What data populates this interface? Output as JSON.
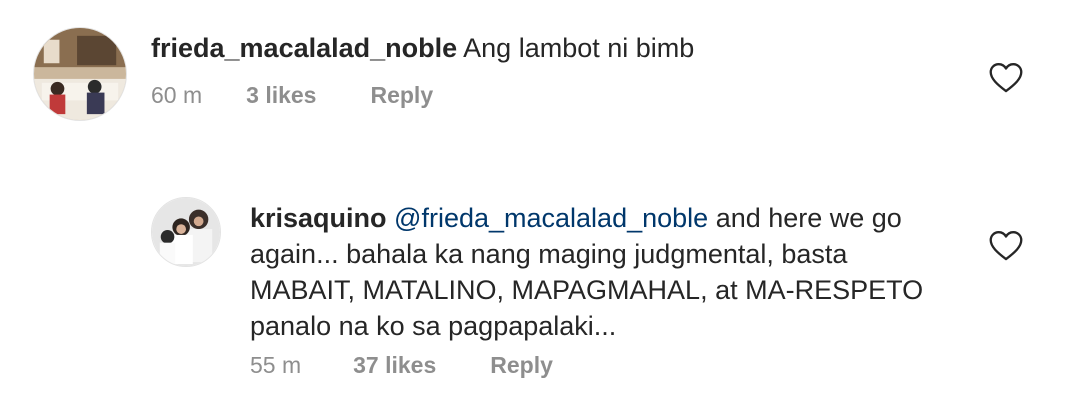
{
  "comments": [
    {
      "username": "frieda_macalalad_noble",
      "text": "Ang lambot ni bimb",
      "time": "60 m",
      "likes": "3 likes",
      "reply": "Reply",
      "like_icon": "heart-outline-icon"
    },
    {
      "username": "krisaquino",
      "mention": "@frieda_macalalad_noble",
      "text_line1": "and here we go",
      "text_line2": "again... bahala ka nang maging judgmental, basta",
      "text_line3": "MABAIT, MATALINO, MAPAGMAHAL, at MA-RESPETO",
      "text_line4": "panalo na ko sa pagpapalaki...",
      "time": "55 m",
      "likes": "37 likes",
      "reply": "Reply",
      "like_icon": "heart-outline-icon"
    }
  ],
  "colors": {
    "text": "#262626",
    "secondary": "#8e8e8e",
    "mention": "#00376b",
    "background": "#ffffff"
  }
}
